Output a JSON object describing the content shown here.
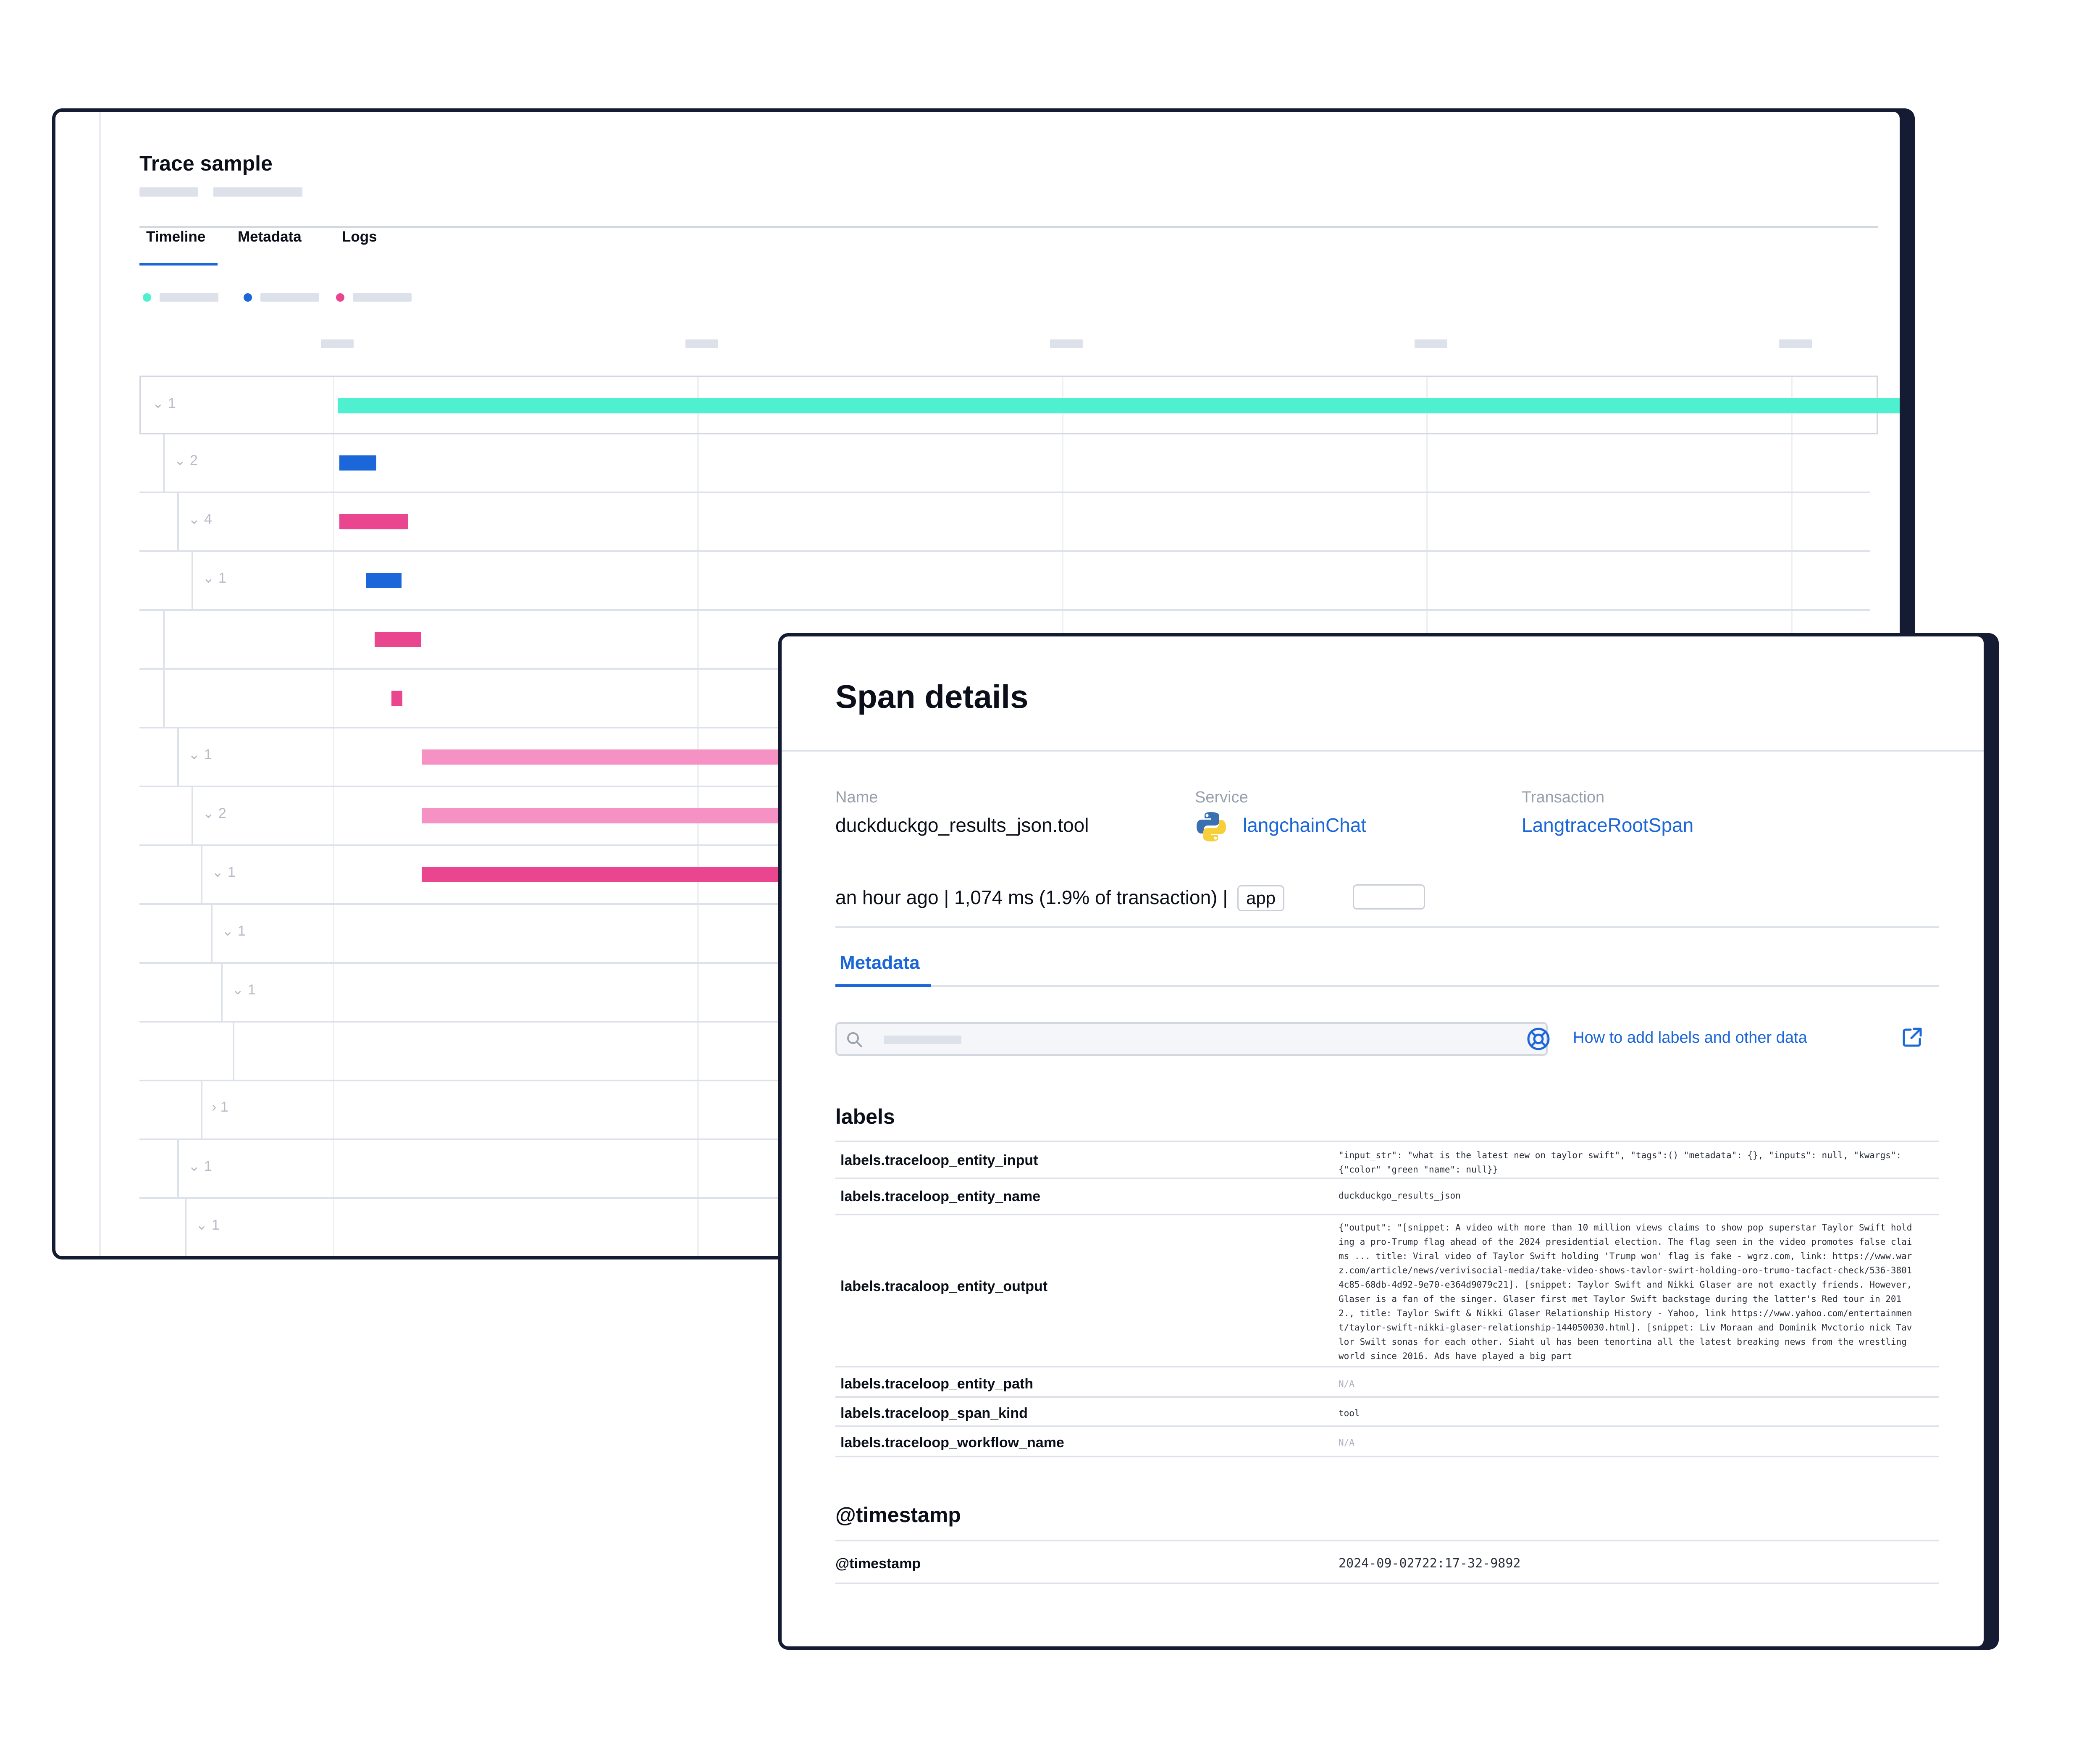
{
  "trace": {
    "title": "Trace sample",
    "tabs": [
      "Timeline",
      "Metadata",
      "Logs"
    ],
    "active_tab": "Timeline",
    "legend_colors": [
      "#4ef0cf",
      "#1b66d8",
      "#e9468f"
    ],
    "rows": [
      {
        "label": "1",
        "chevron": "down",
        "color": "#4ef0cf"
      },
      {
        "label": "2",
        "chevron": "down",
        "color": "#1b66d8"
      },
      {
        "label": "4",
        "chevron": "down",
        "color": "#e9468f"
      },
      {
        "label": "1",
        "chevron": "down",
        "color": "#1b66d8"
      },
      {
        "label": "",
        "chevron": "",
        "color": "#e9468f"
      },
      {
        "label": "",
        "chevron": "",
        "color": "#e9468f"
      },
      {
        "label": "1",
        "chevron": "down",
        "color": "#f592c3"
      },
      {
        "label": "2",
        "chevron": "down",
        "color": "#f592c3"
      },
      {
        "label": "1",
        "chevron": "down",
        "color": "#e9468f"
      },
      {
        "label": "1",
        "chevron": "down",
        "color": ""
      },
      {
        "label": "1",
        "chevron": "down",
        "color": ""
      },
      {
        "label": "",
        "chevron": "",
        "color": ""
      },
      {
        "label": "1",
        "chevron": "right",
        "color": ""
      },
      {
        "label": "1",
        "chevron": "down",
        "color": ""
      },
      {
        "label": "1",
        "chevron": "down",
        "color": ""
      }
    ]
  },
  "span": {
    "title": "Span details",
    "name_label": "Name",
    "name_value": "duckduckgo_results_json.tool",
    "service_label": "Service",
    "service_value": "langchainChat",
    "service_icon": "python-icon",
    "transaction_label": "Transaction",
    "transaction_value": "LangtraceRootSpan",
    "meta_line": "an hour ago | 1,074 ms (1.9% of transaction) |",
    "chip": "app",
    "tab": "Metadata",
    "help_link": "How to add labels and other data",
    "labels_title": "labels",
    "labels": [
      {
        "key": "labels.traceloop_entity_input",
        "value": "\"input_str\": \"what is the latest new on taylor swift\", \"tags\":() \"metadata\": {}, \"inputs\": null, \"kwargs\": {\"color\" \"green \"name\": null}}"
      },
      {
        "key": "labels.traceloop_entity_name",
        "value": "duckduckgo_results_json"
      },
      {
        "key": "labels.tracaloop_entity_output",
        "value": "{\"output\": \"[snippet: A video with more than 10 million views claims to show pop superstar Taylor Swift holding a pro-Trump flag ahead of the 2024 presidential election. The flag seen in the video promotes false claims ... title: Viral video of Taylor Swift holding 'Trump won' flag is fake - wgrz.com, link: https://www.warz.com/article/news/verivisocial-media/take-video-shows-tavlor-swirt-holding-oro-trumo-tacfact-check/536-38014c85-68db-4d92-9e70-e364d9079c21]. [snippet: Taylor Swift and Nikki Glaser are not exactly friends. However, Glaser is a fan of the singer. Glaser first met Taylor Swift backstage during the latter's Red tour in 2012., title: Taylor Swift & Nikki Glaser Relationship History - Yahoo, link https://www.yahoo.com/entertainment/taylor-swift-nikki-glaser-relationship-144050030.html]. [snippet: Liv Moraan and Dominik Mvctorio nick Tavlor Swilt sonas for each other. Siaht ul has been tenortina all the latest breaking news from the wrestling world since 2016. Ads have played a big part"
      },
      {
        "key": "labels.traceloop_entity_path",
        "value": "N/A"
      },
      {
        "key": "labels.traceloop_span_kind",
        "value": "tool"
      },
      {
        "key": "labels.traceloop_workflow_name",
        "value": "N/A"
      }
    ],
    "timestamp_title": "@timestamp",
    "timestamp_key": "@timestamp",
    "timestamp_value": "2024-09-02722:17-32-9892"
  }
}
